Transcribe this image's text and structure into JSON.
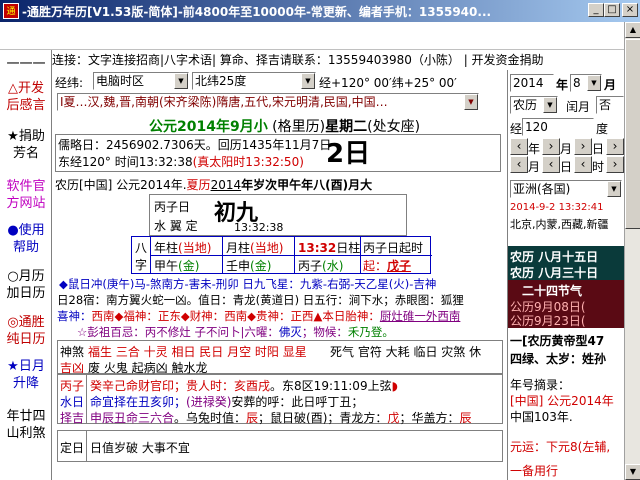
{
  "window": {
    "title": "-通胜万年历[V1.53版-简体]-前4800年至10000年-常更新、编者手机：1355940...",
    "icon_text": "通胜"
  },
  "linkbar": {
    "text": "连接：文字连接招商|八字术语| 算命、择吉请联系：13559403980（小陈） | 开发资金捐助"
  },
  "sidebar": {
    "items": [
      {
        "label": "一一一",
        "color": "#000000"
      },
      {
        "label": "△开发后感言",
        "color": "#c00000"
      },
      {
        "label": "★捐助芳名",
        "color": "#000000"
      },
      {
        "label": "软件官方网站",
        "color": "#c000c0"
      },
      {
        "label": "●使用帮助",
        "color": "#0000c0"
      },
      {
        "label": "○月历加日历",
        "color": "#000000"
      },
      {
        "label": "◎通胜纯日历",
        "color": "#c00000"
      },
      {
        "label": "★日月升降",
        "color": "#0000c0"
      },
      {
        "label": "年廿四山利煞",
        "color": "#000000"
      }
    ]
  },
  "location": {
    "longitude_label": "经纬:",
    "timezone_value": "电脑时区",
    "latitude_value": "北纬25度",
    "coord_text": "经+120° 00′纬+25° 00′"
  },
  "dynasty": {
    "value": "Ⅰ夏…汉,魏,晋,南朝(宋齐梁陈)隋唐,五代,宋元明清,民国,中国…"
  },
  "date_header": {
    "solar": "公元2014年9月小",
    "calendar": "(格里历)",
    "weekday": "星期二",
    "constellation": "(处女座)",
    "julian": "儒略日：2456902.7306天。回历1435年11月7日",
    "time_line_prefix": "东经120° 时间13:32:38",
    "true_solar": "(真太阳时13:32:50)",
    "big_day": "2日"
  },
  "lunar": {
    "line_prefix": "农历[中国] 公元2014年.",
    "dynasty": "夏历",
    "year": "2014",
    "year_rest": "年岁次甲午年八(酉)月大"
  },
  "day_box": {
    "label1": "丙子日",
    "big": "初九",
    "label2": "水 翼 定",
    "time": "13:32:38"
  },
  "bazi": {
    "side_label_1": "八",
    "side_label_2": "字",
    "year": {
      "top": "年柱",
      "top_note": "(当地)",
      "bottom": "甲午",
      "element": "(金)"
    },
    "month": {
      "top": "月柱",
      "top_note": "(当地)",
      "bottom": "壬申",
      "element": "(金)"
    },
    "day": {
      "top": "13:32",
      "top_note": "日柱",
      "bottom": "丙子",
      "element": "(水)"
    },
    "hour": {
      "top": "丙子日起时",
      "bottom_prefix": "起：",
      "bottom": "戊子"
    }
  },
  "info_lines": {
    "line1": "◆鼠日冲(庚午)马-煞南方-害未-刑卯 日九飞星：九紫-右弼-天乙星(火)-吉神",
    "line2": "日28宿：南方翼火蛇一凶。值日：青龙(黄道日) 日五行：涧下水；赤眼图：狐狸",
    "line3_a": "喜神：",
    "line3_b": "西南◆福神：",
    "line3_c": "正东◆财神：",
    "line3_d": "西南◆贵神：",
    "line3_e": "正西▲本日胎神：",
    "line3_f": "厨灶碓一外西南",
    "line4_a": "☆彭祖百忌：丙不修灶 子不问卜|六曜：",
    "line4_b": "佛灭",
    "line4_c": "；物候：",
    "line4_d": "禾乃登。"
  },
  "shensha": {
    "label": "神煞",
    "good": "福生 三合 十灵 相日 民日 月空 时阳 显星",
    "bad": "死气 官符 大耗 临日 灾煞 休",
    "good_label": "吉凶",
    "bad2": "废 火鬼 起病凶 触水龙"
  },
  "hours": {
    "label1": "丙子",
    "label2": "水日",
    "label3": "择吉",
    "row1_a": "癸辛己命财官印",
    "row1_b": "；贵人时：",
    "row1_c": "亥酉戌",
    "row1_d": "。东8区19:11:09上弦",
    "row2_a": "命宜择在丑亥卯；",
    "row2_b": "(进禄癸)",
    "row2_c": "安葬的呼：此日呼丁丑；",
    "row3_a": "申辰丑命三六合",
    "row3_b": "。乌兔时值：",
    "row3_c": "辰",
    "row3_d": "；鼠日破(酉)；青龙方：",
    "row3_e": "戊",
    "row3_f": "；华盖方：",
    "row3_g": "辰"
  },
  "dingri": {
    "label": "定日",
    "text": "日值岁破 大事不宜"
  },
  "right_panel": {
    "year_value": "2014",
    "year_label": "年",
    "month_value": "8",
    "month_label": "月",
    "cal_type": "农历",
    "leap_label": "闰月",
    "leap_value": "否",
    "long_label": "经",
    "long_value": "120",
    "jd_label": "度",
    "nav_year_prev": "年",
    "nav_year_next": "年",
    "nav_month_prev": "月",
    "nav_month_next": "月",
    "nav_day_prev": "日",
    "nav_day_next": "日",
    "nav_hour_prev": "时",
    "nav_hour_next": "时",
    "region": "亚洲(各国)",
    "dt_line": "2014-9-2 13:32:41",
    "place": "北京,内蒙,西藏,新疆",
    "dark1": "农历 八月十五日",
    "dark2": "农历 八月三十日",
    "term_title": "二十四节气",
    "term1": "公历9月08日(",
    "term2": "公历9月23日(",
    "huangdi": "一[农历黄帝型47",
    "sitai": "四绿、太岁：姓孙",
    "year_note_label": "年号摘录：",
    "year_note": "[中国] 公元2014年",
    "year_note2": "中国103年.",
    "yuanyun": "元运：下元8(左辅,",
    "beiyong": "一备用行"
  }
}
